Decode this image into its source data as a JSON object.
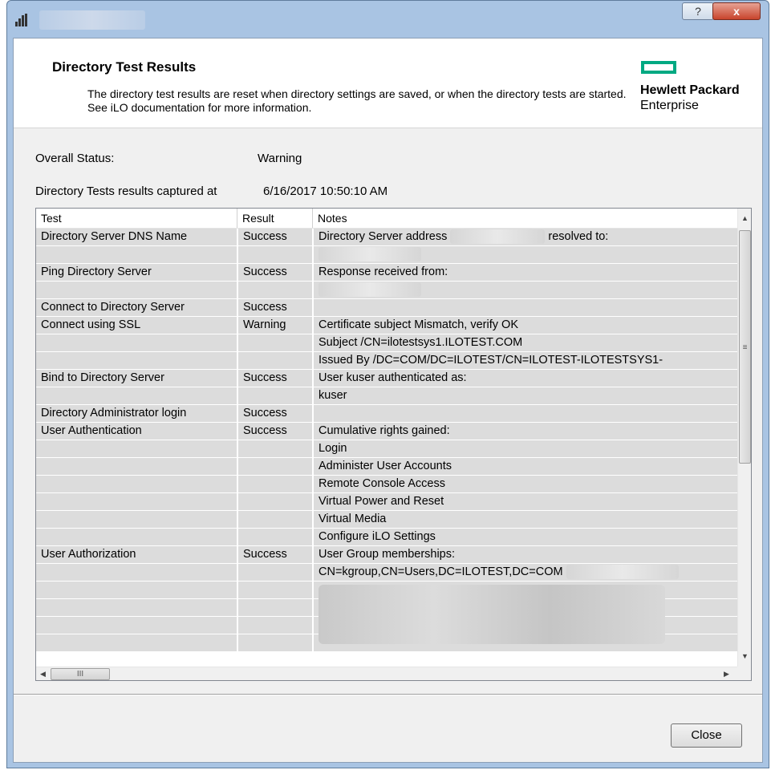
{
  "window": {
    "help_glyph": "?",
    "close_glyph": "x"
  },
  "header": {
    "title": "Directory Test Results",
    "description": "The directory test results are reset when directory settings are saved, or when the directory tests are started. See iLO documentation for more information.",
    "logo_line1": "Hewlett Packard",
    "logo_line2": "Enterprise",
    "logo_color": "#01a982"
  },
  "status": {
    "overall_label": "Overall Status:",
    "overall_value": "Warning",
    "captured_label": "Directory Tests results captured at",
    "captured_value": "6/16/2017 10:50:10 AM"
  },
  "table": {
    "columns": [
      "Test",
      "Result",
      "Notes"
    ],
    "rows": [
      [
        "Directory Server DNS Name",
        "Success",
        "Directory Server address"
      ],
      [
        "",
        "",
        ""
      ],
      [
        "Ping Directory Server",
        "Success",
        "Response received from:"
      ],
      [
        "",
        "",
        ""
      ],
      [
        "Connect to Directory Server",
        "Success",
        ""
      ],
      [
        "Connect using SSL",
        "Warning",
        "Certificate subject Mismatch, verify OK"
      ],
      [
        "",
        "",
        "Subject /CN=ilotestsys1.ILOTEST.COM"
      ],
      [
        "",
        "",
        "Issued By /DC=COM/DC=ILOTEST/CN=ILOTEST-ILOTESTSYS1-"
      ],
      [
        "Bind to Directory Server",
        "Success",
        "User kuser authenticated as:"
      ],
      [
        "",
        "",
        "kuser"
      ],
      [
        "Directory Administrator login",
        "Success",
        ""
      ],
      [
        "User Authentication",
        "Success",
        "Cumulative rights gained:"
      ],
      [
        "",
        "",
        "Login"
      ],
      [
        "",
        "",
        "Administer User Accounts"
      ],
      [
        "",
        "",
        "Remote Console Access"
      ],
      [
        "",
        "",
        "Virtual Power and Reset"
      ],
      [
        "",
        "",
        "Virtual Media"
      ],
      [
        "",
        "",
        "Configure iLO Settings"
      ],
      [
        "User Authorization",
        "Success",
        "User Group memberships:"
      ],
      [
        "",
        "",
        "CN=kgroup,CN=Users,DC=ILOTEST,DC=COM"
      ],
      [
        "",
        "",
        ""
      ],
      [
        "",
        "",
        ""
      ],
      [
        "",
        "",
        ""
      ],
      [
        "",
        "",
        ""
      ]
    ],
    "row0_suffix": "resolved to:",
    "hscroll_grip": "III",
    "vscroll_grip": "≡"
  },
  "footer": {
    "close_label": "Close"
  }
}
